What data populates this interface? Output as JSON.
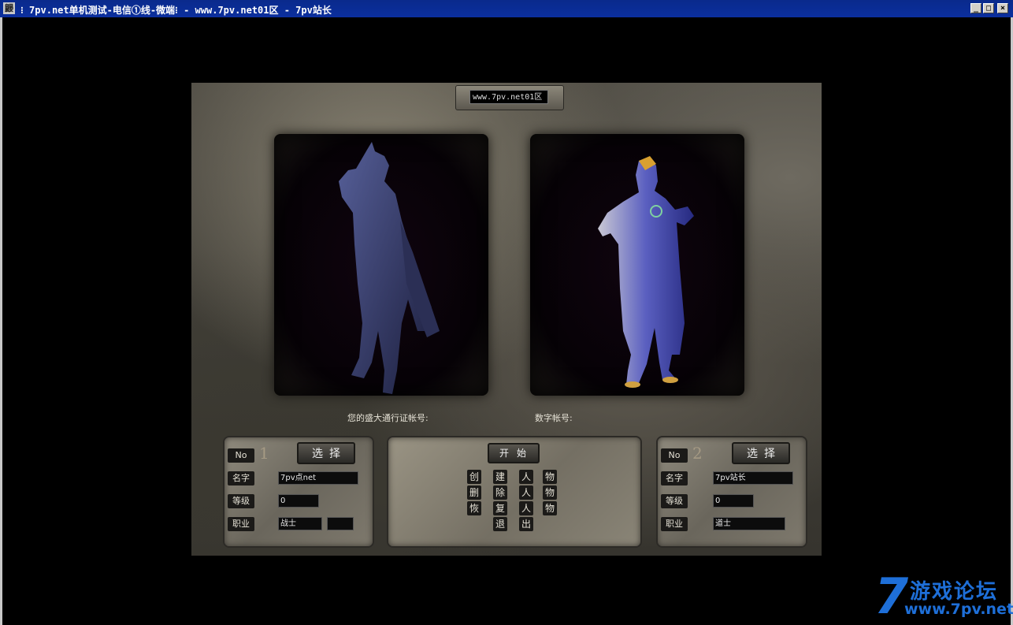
{
  "window": {
    "icon_text": "鼹",
    "title": "⁝ 7pv.net单机测试-电信①线-微端⁝ - www.7pv.net01区 - 7pv站长",
    "minimize": "_",
    "maximize": "□",
    "close": "×"
  },
  "game": {
    "server_name": "www.7pv.net01区",
    "account_label": "您的盛大通行证帐号:",
    "digit_account_label": "数字帐号:",
    "slots": [
      {
        "no_label": "No",
        "no_number": "1",
        "select_label": "选择",
        "name_label": "名字",
        "name_value": "7pv点net",
        "level_label": "等级",
        "level_value": "0",
        "class_label": "职业",
        "class_value": "战士"
      },
      {
        "no_label": "No",
        "no_number": "2",
        "select_label": "选择",
        "name_label": "名字",
        "name_value": "7pv站长",
        "level_label": "等级",
        "level_value": "0",
        "class_label": "职业",
        "class_value": "道士"
      }
    ],
    "start_label": "开始",
    "commands": {
      "create": [
        "创",
        "建",
        "人",
        "物"
      ],
      "delete": [
        "删",
        "除",
        "人",
        "物"
      ],
      "restore": [
        "恢",
        "复",
        "人",
        "物"
      ],
      "exit": [
        "退",
        "出"
      ]
    }
  },
  "watermark": {
    "seven": "7",
    "text": "游戏论坛",
    "url": "www.7pv.net"
  },
  "colors": {
    "titlebar": "#0b2f9e",
    "watermark": "#1e6fd8"
  }
}
